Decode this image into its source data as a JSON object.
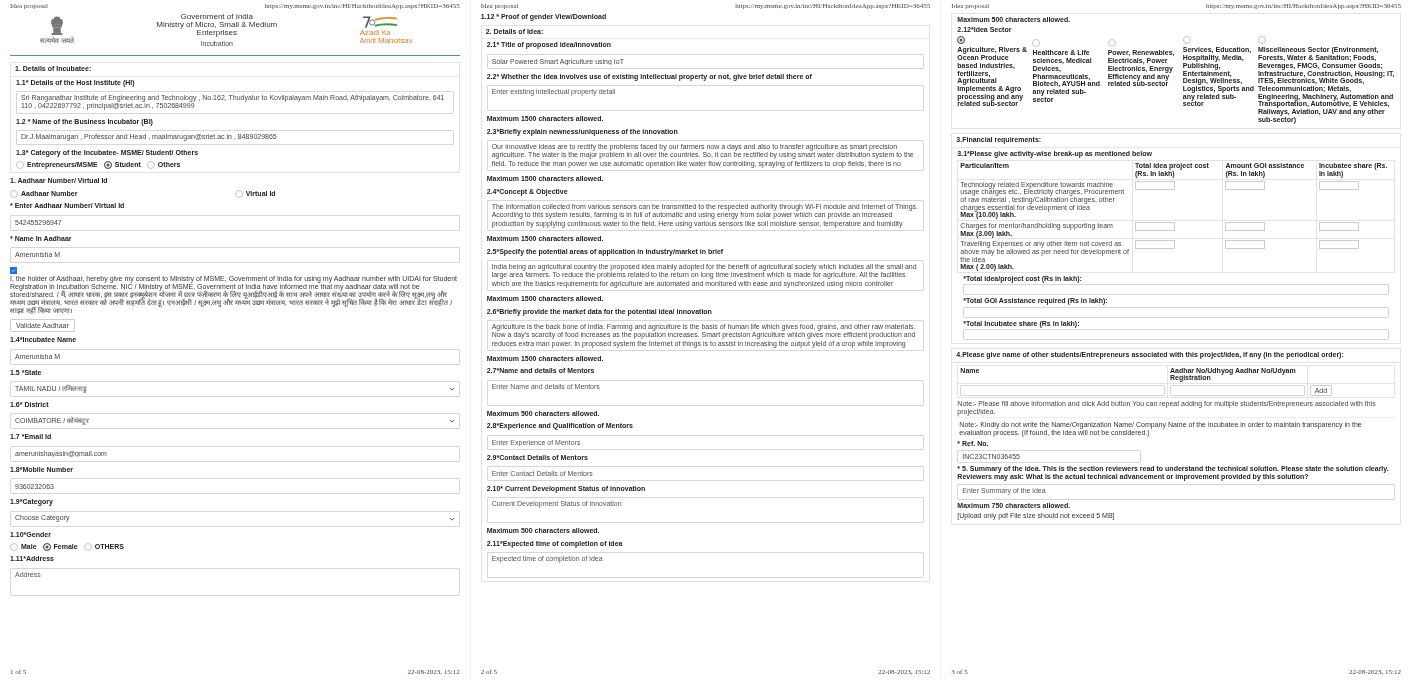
{
  "pages": [
    {
      "header": {
        "title": "Idea proposal",
        "url": "https://my.msme.gov.in/inc/HI/HackthonIdeaApp.aspx?HKID=36455"
      },
      "masthead": {
        "emblem_caption": "सत्यमेव जयते",
        "title_lines": [
          "Government of India",
          "Ministry of Micro, Small & Medium",
          "Enterprises"
        ],
        "subtitle": "Incubation",
        "logo_words": [
          "Azadi",
          "Ka",
          "Amrit",
          "Mahotsav"
        ]
      },
      "blocks": [
        {
          "kind": "panel",
          "title": "1. Details of Incubatee:",
          "children": [
            {
              "kind": "label",
              "text": "1.1* Details of the Host Institute (HI)"
            },
            {
              "kind": "area",
              "value": "Sri Ranganathar Institute of Engineering and Technology , No.162, Thudyalur to Kovilpalayam Main Road, Athipalayam, Coimbatore,      641 110 , 04222697792 , principal@sriet.ac.in , 7502684999"
            },
            {
              "kind": "label",
              "text": "1.2 * Name of the Business Incubator (BI)"
            },
            {
              "kind": "area",
              "value": "Dr.J.Maalmarugan , Professor and Head  , maalmarugan@sriet.ac.in , 8489029865"
            },
            {
              "kind": "label",
              "text": "1.3* Category of the Incubatee- MSME/ Student/ Others"
            },
            {
              "kind": "radios",
              "options": [
                {
                  "label": "Entrepreneurs/MSME",
                  "selected": false
                },
                {
                  "label": "Student",
                  "selected": true
                },
                {
                  "label": "Others",
                  "selected": false
                }
              ]
            }
          ]
        },
        {
          "kind": "label",
          "text": "1. Aadhaar Number/ Virtual Id"
        },
        {
          "kind": "radios-split",
          "options": [
            {
              "label": "Aadhaar Number",
              "selected": false
            },
            {
              "label": "Virtual Id",
              "selected": false
            }
          ]
        },
        {
          "kind": "label",
          "text": "* Enter Aadhaar Number/ Virtual Id"
        },
        {
          "kind": "input",
          "value": "542455296947"
        },
        {
          "kind": "label",
          "text": "* Name In Aadhaar"
        },
        {
          "kind": "input",
          "value": "Amerunisha M"
        },
        {
          "kind": "consent",
          "checked": true,
          "text": "I, the holder of Aadhaar, hereby give my consent to Ministry of MSME, Government of India for using my Aadhaar number with UIDAI for Student Registration in Incubation Scheme. NIC / Ministry of MSME, Government of India have informed me that my aadhaar data will not be stored/shared. / मैं, आधार धारक, इस प्रकार इनक्यूबेशन योजना में छात्र पंजीकरण के लिए यूआईडीएआई के साथ अपने आधार संख्या का उपयोग करने के लिए सूक्ष्म,लघु और मध्यम उद्यम मंत्रालय, भारत सरकार को अपनी सहमति देता हूं। एनआईसी / सूक्ष्म,लघु और मध्यम उद्यम मंत्रालय, भारत सरकार ने मुझे सूचित किया है कि मेरा आधार डेटा संग्रहीत / साझा नहीं किया जाएगा।"
        },
        {
          "kind": "button",
          "text": "Validate Aadhaar"
        },
        {
          "kind": "label",
          "text": "1.4*Incubatee Name"
        },
        {
          "kind": "input",
          "value": "Amerunisha M"
        },
        {
          "kind": "label",
          "text": "1.5 *State"
        },
        {
          "kind": "select",
          "value": "TAMIL NADU / तमिलनाडु"
        },
        {
          "kind": "label",
          "text": "1.6* District"
        },
        {
          "kind": "select",
          "value": "COIMBATORE / कोयंबटूर"
        },
        {
          "kind": "label",
          "text": "1.7 *Email Id"
        },
        {
          "kind": "input",
          "value": "amerunishayasin@gmail.com"
        },
        {
          "kind": "label",
          "text": "1.8*Mobile Number"
        },
        {
          "kind": "input",
          "value": "9360232063"
        },
        {
          "kind": "label",
          "text": "1.9*Category"
        },
        {
          "kind": "select",
          "value": "Choose Category"
        },
        {
          "kind": "label",
          "text": "1.10*Gender"
        },
        {
          "kind": "radios",
          "options": [
            {
              "label": "Male",
              "selected": false
            },
            {
              "label": "Female",
              "selected": true
            },
            {
              "label": "OTHERS",
              "selected": false
            }
          ]
        },
        {
          "kind": "label",
          "text": "1.11*Address"
        },
        {
          "kind": "textarea",
          "placeholder": "Address"
        }
      ],
      "footer": {
        "page": "1 of 5",
        "date": "22-08-2023, 15:12"
      }
    },
    {
      "header": {
        "title": "Idea proposal",
        "url": "https://my.msme.gov.in/inc/HI/HackthonIdeaApp.aspx?HKID=36455"
      },
      "blocks": [
        {
          "kind": "label",
          "text": "1.12 * Proof of gender View/Download"
        },
        {
          "kind": "panel",
          "title": "2. Details of Idea:",
          "children": [
            {
              "kind": "label",
              "text": "2.1* Title of proposed idea/innovation"
            },
            {
              "kind": "input",
              "value": "Solar Powered Smart Agriculture using IoT"
            },
            {
              "kind": "label",
              "text": "2.2* Whether the idea involves use of existing intellectual property or not, give brief detail there of"
            },
            {
              "kind": "textarea",
              "placeholder": "Enter existing intellectual property detail"
            },
            {
              "kind": "limit",
              "text": "Maximum 1500 characters allowed."
            },
            {
              "kind": "label",
              "text": "2.3*Briefly explain newness/uniqueness of the innovation"
            },
            {
              "kind": "area",
              "value": "Our innovative ideas are to rectify the problems faced by our farmers now a days and also to transfer agriculture as smart precision agriculture. The water is the major problem in all over the countries. So, it can be rectified by using smart water distribution system to the field. To reduce the man power we use automatic operation like water flow controlling, spraying of fertilizers to crop fields, there is no"
            },
            {
              "kind": "limit",
              "text": "Maximum 1500 characters allowed."
            },
            {
              "kind": "label",
              "text": "2.4*Concept & Objective"
            },
            {
              "kind": "area",
              "value": "The information collected from various sensors can be transmitted to the respected authority through Wi-Fi module and Internet of Things. According to this system results, farming is in full of automatic and using energy from solar power which can provide an increased production by supplying continuous water to the field. Here using various sensors like soil moisture sensor, temperature and humidity"
            },
            {
              "kind": "limit",
              "text": "Maximum 1500 characters allowed."
            },
            {
              "kind": "label",
              "text": "2.5*Specify the potential areas of application in industry/market in brief"
            },
            {
              "kind": "area",
              "value": "India being an agricultural country the proposed idea mainly adopted for the benefit of agricultural society which includes all the small and large area farmers. To reduce the problems related to the return on long time investment which is made for agriculture. All the facilities which are the basics requirements for agriculture are automated and monitored with ease and synchronized using micro controller"
            },
            {
              "kind": "limit",
              "text": "Maximum 1500 characters allowed."
            },
            {
              "kind": "label",
              "text": "2.6*Briefly provide the market data for the potential idea/ innovation"
            },
            {
              "kind": "area",
              "value": "Agriculture is the back bone of India. Farming and agriculture is the basis of human life which gives food, grains, and other raw materials. Now a day's scarcity of food increases as the population increases. Smart precision Agriculture which gives more efficient production and reduces extra man power. In proposed system the Internet of things is to assist in increasing the output yield of a crop while improving"
            },
            {
              "kind": "limit",
              "text": "Maximum 1500 characters allowed."
            },
            {
              "kind": "label",
              "text": "2.7*Name and details of Mentors"
            },
            {
              "kind": "textarea",
              "placeholder": "Enter Name and details of Mentors"
            },
            {
              "kind": "limit",
              "text": "Maximum 500 characters allowed."
            },
            {
              "kind": "label",
              "text": "2.8*Experience and Qualification of Mentors"
            },
            {
              "kind": "input",
              "placeholder": "Enter Experience of Mentors"
            },
            {
              "kind": "label",
              "text": "2.9*Contact Details of Mentors"
            },
            {
              "kind": "input",
              "placeholder": "Enter Contact Details of Mentors"
            },
            {
              "kind": "label",
              "text": "2.10* Current Development Status of innovation"
            },
            {
              "kind": "textarea",
              "placeholder": "Current Development Status of innovation"
            },
            {
              "kind": "limit",
              "text": "Maximum 500 characters allowed."
            },
            {
              "kind": "label",
              "text": "2.11*Expected time of completion of idea"
            },
            {
              "kind": "textarea",
              "placeholder": "Expected time of completion of idea"
            }
          ]
        }
      ],
      "footer": {
        "page": "2 of 5",
        "date": "22-08-2023, 15:12"
      }
    },
    {
      "header": {
        "title": "Idea proposal",
        "url": "https://my.msme.gov.in/inc/HI/HackthonIdeaApp.aspx?HKID=36455"
      },
      "blocks": [
        {
          "kind": "panel",
          "children": [
            {
              "kind": "limit",
              "text": "Maximum 500 characters allowed."
            },
            {
              "kind": "label",
              "text": "2.12*Idea Sector"
            },
            {
              "kind": "sectors",
              "options": [
                {
                  "label": "Agriculture, Rivers & Ocean Produce based industries, fertilizers, Agricultural Implements & Agro processing and any related sub-sector",
                  "selected": true
                },
                {
                  "label": "Healthcare & Life sciences, Medical Devices, Pharmaceuticals, Biotech, AYUSH and any related sub-sector",
                  "selected": false
                },
                {
                  "label": "Power, Renewables, Electricals, Power Electronics, Energy Efficiency and any related sub-sector",
                  "selected": false
                },
                {
                  "label": "Services, Education, Hospitality, Media, Publishing, Entertainment, Design, Wellness, Logistics, Sports and any related sub-sector",
                  "selected": false
                },
                {
                  "label": "Miscellaneous Sector (Environment, Forests, Water & Sanitation; Foods, Beverages, FMCG, Consumer Goods; Infrastructure, Construction, Housing; IT, ITES, Electronics, White Goods, Telecommunication; Metals, Engineering, Machinery, Automation and Transportation, Automotive, E Vehicles, Railways, Aviation, UAV and any other sub-sector)",
                  "selected": false
                }
              ]
            }
          ]
        },
        {
          "kind": "panel",
          "title": "3.Financial requirements:",
          "children": [
            {
              "kind": "label",
              "text": "3.1*Please give activity-wise break-up as mentioned below"
            },
            {
              "kind": "cost-table",
              "columns": [
                "Particular/Item",
                "Total idea project cost (Rs. In lakh)",
                "Amount GOI assistance (Rs. In lakh)",
                "Incubatee share (Rs. In lakh)"
              ],
              "rows": [
                {
                  "item": "Technology related Expenditure towards machine usage charges etc., Electricity charges, Procurement of raw material , testing/Calibration charges, other charges essential for development of idea",
                  "max": "Max (10.00) lakh."
                },
                {
                  "item": "Charges for mentor/handholding supporting team",
                  "max": "Max (3.00) lakh."
                },
                {
                  "item": "Travelling Expenses or any other item not coverd as above may be allowed as per need for development of the idea",
                  "max": "Max ( 2.00) lakh."
                }
              ]
            },
            {
              "kind": "total",
              "text": "*Total idea/project cost (Rs in lakh):"
            },
            {
              "kind": "total",
              "text": "*Total GOI Assistance required (Rs in lakh):"
            },
            {
              "kind": "total",
              "text": "*Total Incubatee share (Rs in lakh):"
            }
          ]
        },
        {
          "kind": "panel",
          "title": "4.Please give name of other students/Entrepreneurs associated with this project/idea, if any (in the periodical order):",
          "children": [
            {
              "kind": "members-table",
              "columns": [
                "Name",
                "Aadhar No/Udhyog Aadhar No/Udyam Registration"
              ],
              "button": "Add"
            },
            {
              "kind": "note",
              "text": "Note:- Please fill above information and click Add button You can repeat adding for multiple students/Entrepreneurs associated with this project/idea."
            },
            {
              "kind": "notice",
              "text": "Note:- Kindly do not write the Name/Organization Name/ Company Name of the incubatee in order to maintain transparency in the evaluation process. (If found, the idea will not be considered.)"
            },
            {
              "kind": "label",
              "text": "* Ref. No."
            },
            {
              "kind": "input-short",
              "value": "INC23CTN036455"
            },
            {
              "kind": "label",
              "text": "* 5. Summary of the idea. This is the section reviewers read to understand the technical solution. Please state the solution clearly. Reviewers may ask: What is the actual technical advancement or improvement provided by this solution?"
            },
            {
              "kind": "textarea",
              "placeholder": "Enter Summary of the idea"
            },
            {
              "kind": "limit",
              "text": "Maximum 750 characters allowed."
            },
            {
              "kind": "small",
              "text": "[Upload only pdf File size should not exceed 5 MB]"
            }
          ]
        }
      ],
      "footer": {
        "page": "3 of 5",
        "date": "22-08-2023, 15:12"
      }
    }
  ]
}
